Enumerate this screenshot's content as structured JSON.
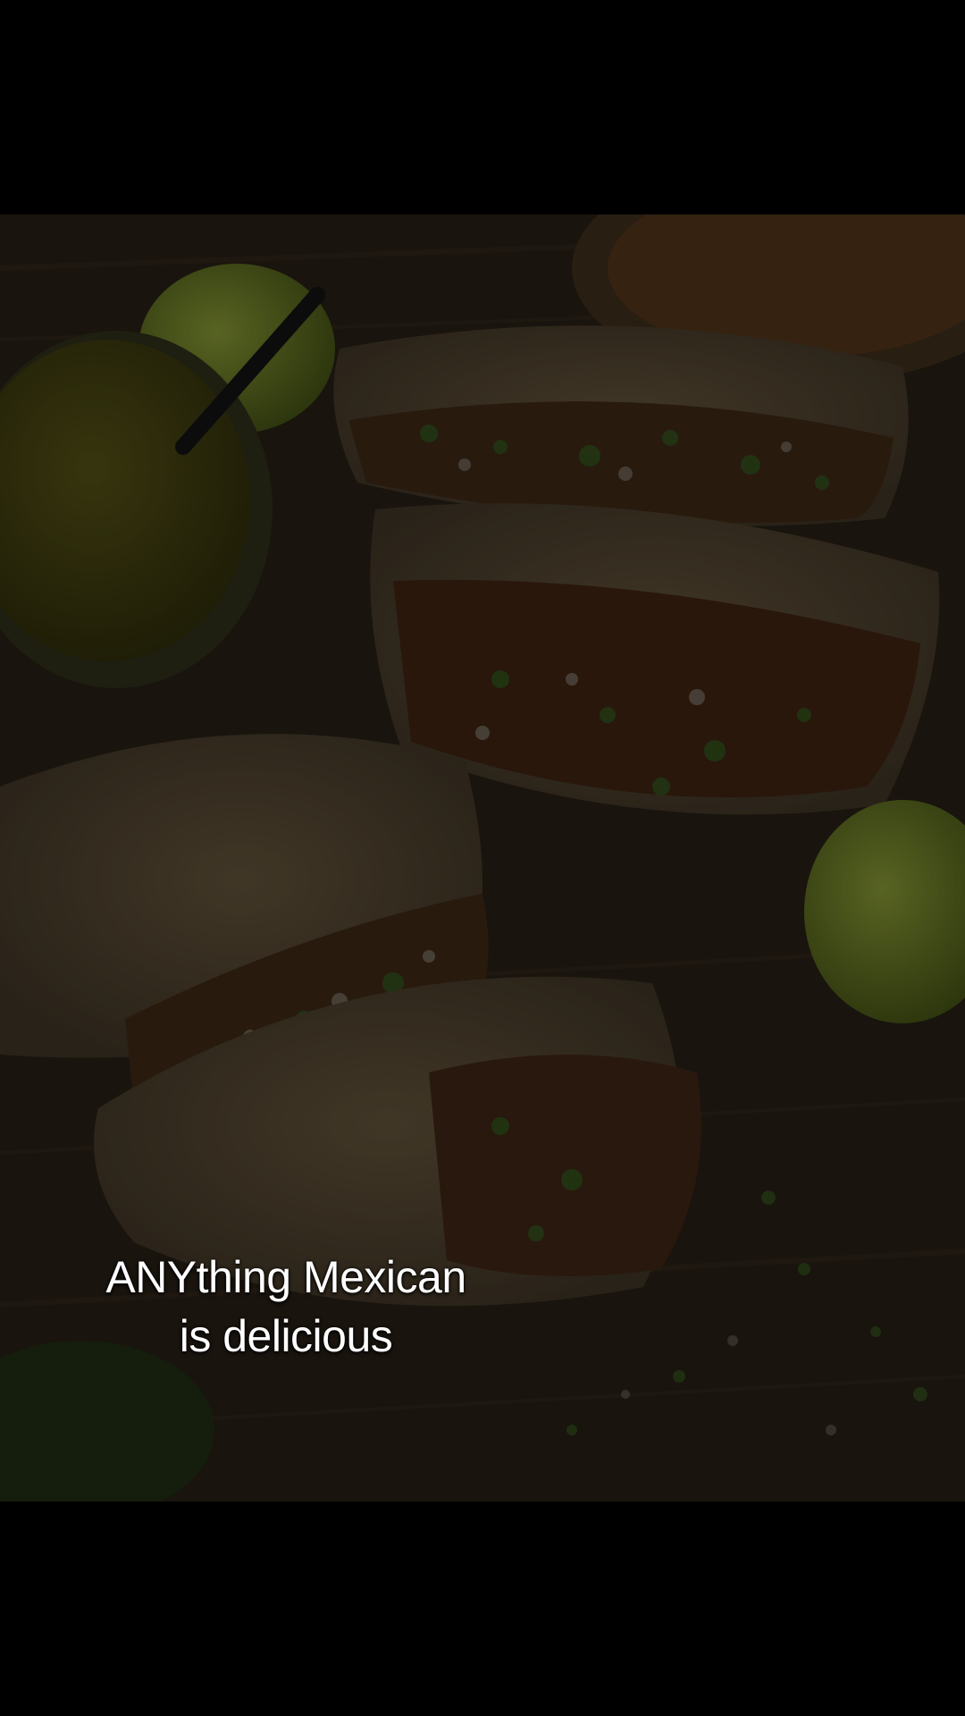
{
  "caption": {
    "line1": "ANYthing Mexican",
    "line2": "is delicious"
  },
  "colors": {
    "background": "#000000",
    "wood": "#2a2218",
    "tortilla": "#4a3e2c",
    "filling": "#3a2414",
    "salsa_verde": "#3d3a10",
    "lime": "#5a6a20",
    "caption_text": "#ffffff"
  }
}
